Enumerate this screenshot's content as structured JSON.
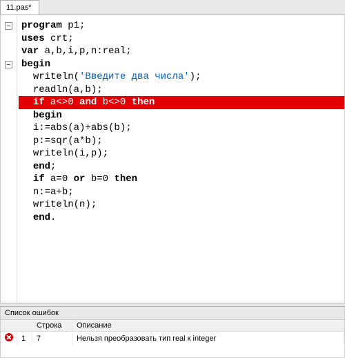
{
  "tab": {
    "label": "11.pas*"
  },
  "code": {
    "lines": [
      {
        "fold": true,
        "indent": 0,
        "tokens": [
          {
            "t": "program",
            "c": "kw"
          },
          {
            "t": " p1;",
            "c": ""
          }
        ]
      },
      {
        "fold": false,
        "indent": 0,
        "tokens": [
          {
            "t": "uses",
            "c": "kw"
          },
          {
            "t": " crt;",
            "c": ""
          }
        ]
      },
      {
        "fold": false,
        "indent": 0,
        "tokens": [
          {
            "t": "var",
            "c": "kw"
          },
          {
            "t": " a,b,i,p,n:real;",
            "c": ""
          }
        ]
      },
      {
        "fold": true,
        "indent": 0,
        "tokens": [
          {
            "t": "begin",
            "c": "kw"
          }
        ]
      },
      {
        "fold": false,
        "indent": 1,
        "tokens": [
          {
            "t": "writeln(",
            "c": ""
          },
          {
            "t": "'Введите два числа'",
            "c": "str"
          },
          {
            "t": ");",
            "c": ""
          }
        ]
      },
      {
        "fold": false,
        "indent": 1,
        "tokens": [
          {
            "t": "readln(a,b);",
            "c": ""
          }
        ]
      },
      {
        "fold": false,
        "indent": 1,
        "err": true,
        "tokens": [
          {
            "t": "if",
            "c": "kw"
          },
          {
            "t": " a<>0 ",
            "c": ""
          },
          {
            "t": "and",
            "c": "kw"
          },
          {
            "t": " b<>0 ",
            "c": ""
          },
          {
            "t": "then",
            "c": "kw"
          }
        ]
      },
      {
        "fold": false,
        "indent": 1,
        "tokens": [
          {
            "t": "begin",
            "c": "kw"
          }
        ]
      },
      {
        "fold": false,
        "indent": 1,
        "tokens": [
          {
            "t": "i:=abs(a)+abs(b);",
            "c": ""
          }
        ]
      },
      {
        "fold": false,
        "indent": 1,
        "tokens": [
          {
            "t": "p:=sqr(a*b);",
            "c": ""
          }
        ]
      },
      {
        "fold": false,
        "indent": 1,
        "tokens": [
          {
            "t": "writeln(i,p);",
            "c": ""
          }
        ]
      },
      {
        "fold": false,
        "indent": 1,
        "tokens": [
          {
            "t": "end",
            "c": "kw"
          },
          {
            "t": ";",
            "c": ""
          }
        ]
      },
      {
        "fold": false,
        "indent": 1,
        "tokens": [
          {
            "t": "if",
            "c": "kw"
          },
          {
            "t": " a=0 ",
            "c": ""
          },
          {
            "t": "or",
            "c": "kw"
          },
          {
            "t": " b=0 ",
            "c": ""
          },
          {
            "t": "then",
            "c": "kw"
          }
        ]
      },
      {
        "fold": false,
        "indent": 1,
        "tokens": [
          {
            "t": "n:=a+b;",
            "c": ""
          }
        ]
      },
      {
        "fold": false,
        "indent": 1,
        "tokens": [
          {
            "t": "writeln(n);",
            "c": ""
          }
        ]
      },
      {
        "fold": false,
        "indent": 1,
        "tokens": [
          {
            "t": "end",
            "c": "kw"
          },
          {
            "t": ".",
            "c": ""
          }
        ]
      }
    ]
  },
  "errors": {
    "title": "Список ошибок",
    "headers": {
      "line": "Строка",
      "desc": "Описание"
    },
    "rows": [
      {
        "num": "1",
        "line": "7",
        "desc": "Нельзя преобразовать тип real к integer"
      }
    ]
  }
}
